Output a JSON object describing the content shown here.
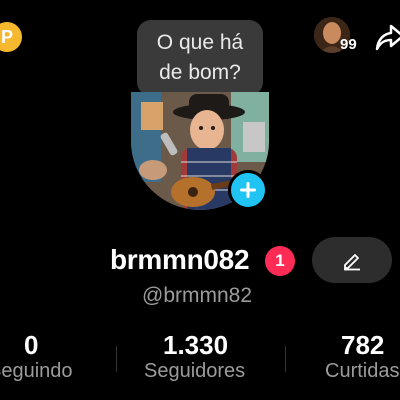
{
  "coin": {
    "symbol": "P",
    "color": "#f5b82e"
  },
  "prompt_bubble": {
    "line1": "O que há",
    "line2": "de bom?"
  },
  "friends": {
    "count": "99"
  },
  "profile": {
    "username": "brmmn082",
    "notification_badge": "1",
    "handle": "@brmmn82"
  },
  "stats": {
    "following": {
      "value": "0",
      "label": "Seguindo"
    },
    "followers": {
      "value": "1.330",
      "label": "Seguidores"
    },
    "likes": {
      "value": "782",
      "label": "Curtidas"
    }
  },
  "colors": {
    "accent_blue": "#20c4f3",
    "badge_red": "#fe2c55",
    "background": "#000000"
  }
}
